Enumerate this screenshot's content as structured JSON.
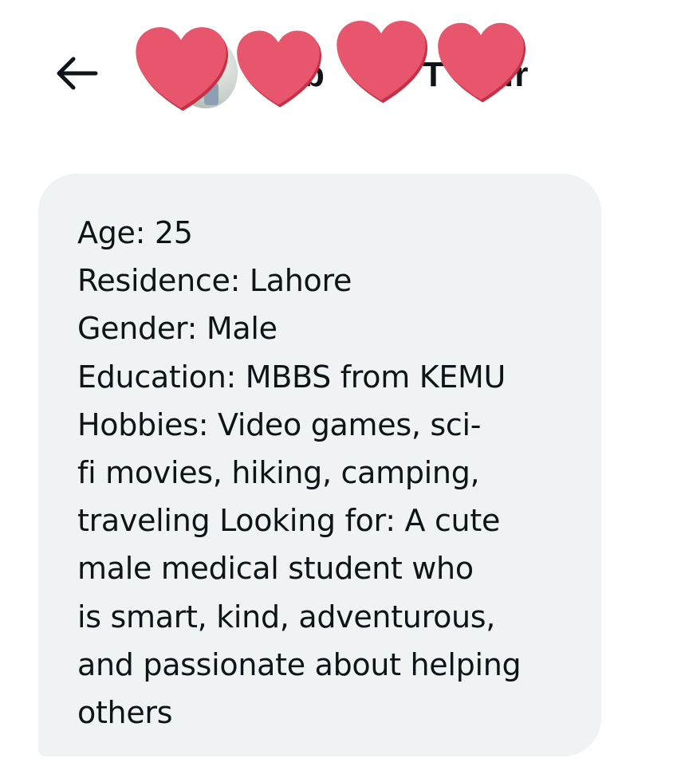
{
  "header": {
    "title_fragments": [
      "b",
      "T",
      "ir"
    ],
    "back_label": "Back",
    "sticker_color": "#e8566e"
  },
  "message": {
    "lines": [
      "Age: 25",
      "Residence: Lahore",
      "Gender: Male",
      "Education: MBBS from KEMU",
      "Hobbies: Video games, sci-",
      "fi movies, hiking, camping,",
      "traveling Looking for: A cute",
      "male medical student who",
      "is smart, kind, adventurous,",
      "and passionate about helping",
      "others"
    ],
    "bubble_color": "#eff3f4",
    "text_color": "#0f1419"
  }
}
